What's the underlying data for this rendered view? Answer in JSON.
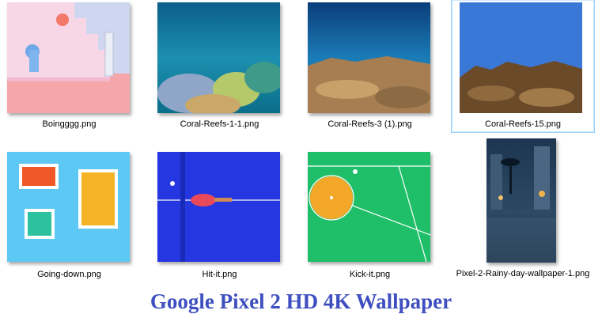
{
  "files": [
    {
      "name": "Boingggg.png",
      "icon": "image-file-icon"
    },
    {
      "name": "Coral-Reefs-1-1.png",
      "icon": "image-file-icon"
    },
    {
      "name": "Coral-Reefs-3 (1).png",
      "icon": "image-file-icon"
    },
    {
      "name": "Coral-Reefs-15.png",
      "icon": "image-file-icon",
      "selected": true
    },
    {
      "name": "Going-down.png",
      "icon": "image-file-icon"
    },
    {
      "name": "Hit-it.png",
      "icon": "image-file-icon"
    },
    {
      "name": "Kick-it.png",
      "icon": "image-file-icon"
    },
    {
      "name": "Pixel-2-Rainy-day-wallpaper-1.png",
      "icon": "image-file-icon"
    }
  ],
  "caption": "Google Pixel 2 HD 4K Wallpaper",
  "colors": {
    "caption": "#3f4fbf",
    "selection_border": "#99d1ff"
  }
}
